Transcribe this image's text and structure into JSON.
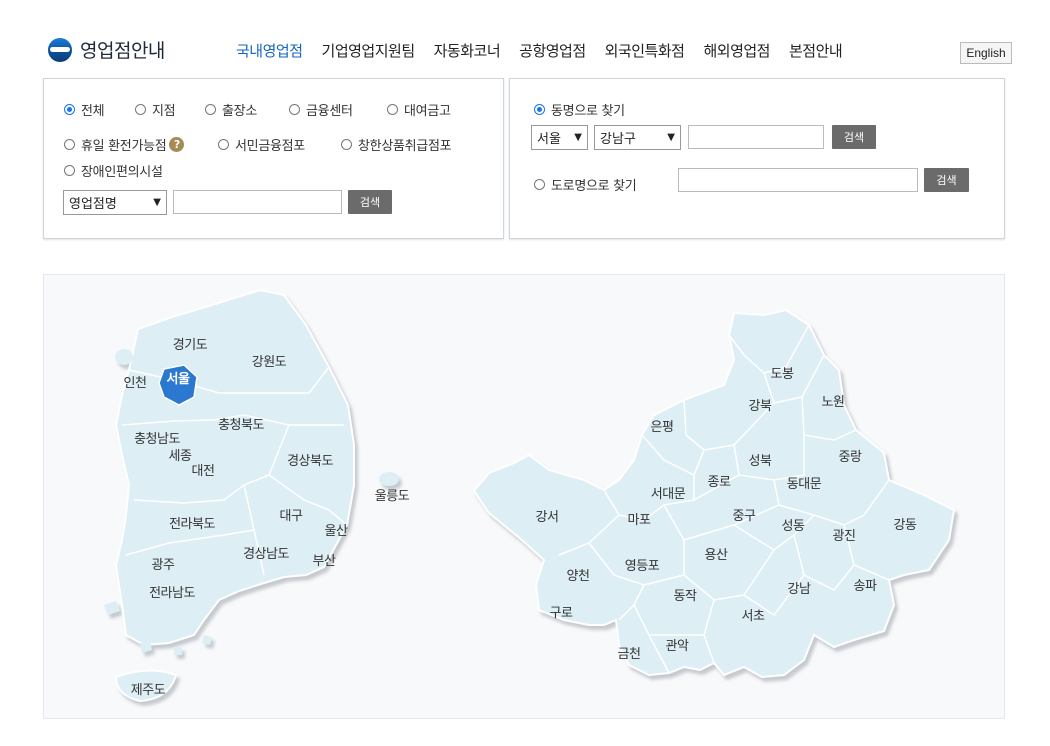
{
  "header": {
    "logo_text": "영업점안내",
    "nav": [
      "국내영업점",
      "기업영업지원팀",
      "자동화코너",
      "공항영업점",
      "외국인특화점",
      "해외영업점",
      "본점안내"
    ],
    "active_nav": "국내영업점",
    "lang_button": "English"
  },
  "branch_search": {
    "types": [
      {
        "label": "전체",
        "checked": true
      },
      {
        "label": "지점",
        "checked": false
      },
      {
        "label": "출장소",
        "checked": false
      },
      {
        "label": "금융센터",
        "checked": false
      },
      {
        "label": "대여금고",
        "checked": false
      },
      {
        "label": "휴일 환전가능점",
        "checked": false
      },
      {
        "label": "서민금융점포",
        "checked": false
      },
      {
        "label": "창한상품취급점포",
        "checked": false
      },
      {
        "label": "장애인편의시설",
        "checked": false
      }
    ],
    "help_icon": "question-icon",
    "field_select": "영업점명",
    "keyword_value": "",
    "search_button": "검색"
  },
  "location_search": {
    "by_dong_label": "동명으로 찾기",
    "by_dong_checked": true,
    "city_select": "서울",
    "district_select": "강남구",
    "dong_value": "",
    "search_button": "검색",
    "by_road_label": "도로명으로 찾기",
    "by_road_checked": false,
    "road_value": "",
    "road_search_button": "검색"
  },
  "colors": {
    "accent": "#1565c0",
    "map_fill": "#ddeef5",
    "map_stroke": "#ffffff",
    "selected_region": "#2a78d0",
    "button": "#6b6b6b"
  },
  "korea_map": {
    "selected": "서울",
    "regions": [
      "경기도",
      "강원도",
      "인천",
      "서울",
      "충청북도",
      "충청남도",
      "세종",
      "대전",
      "경상북도",
      "울릉도",
      "전라북도",
      "대구",
      "울산",
      "광주",
      "경상남도",
      "부산",
      "전라남도",
      "제주도"
    ]
  },
  "seoul_map": {
    "districts": [
      "도봉",
      "노원",
      "강북",
      "은평",
      "중랑",
      "성북",
      "종로",
      "동대문",
      "서대문",
      "강서",
      "마포",
      "중구",
      "광진",
      "성동",
      "강동",
      "양천",
      "영등포",
      "용산",
      "구로",
      "동작",
      "강남",
      "송파",
      "서초",
      "금천",
      "관악"
    ]
  }
}
